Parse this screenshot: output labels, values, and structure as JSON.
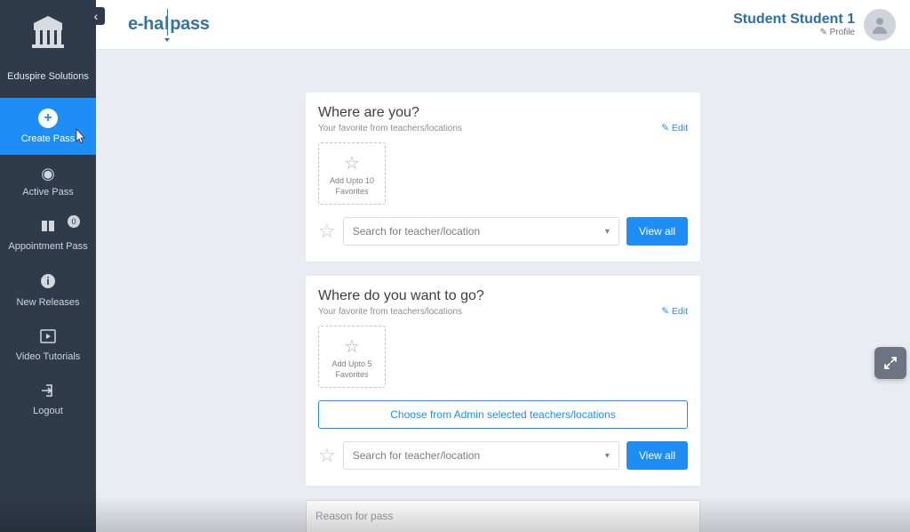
{
  "sidebar": {
    "org": "Eduspire Solutions",
    "items": [
      {
        "key": "create-pass",
        "label": "Create Pass"
      },
      {
        "key": "active-pass",
        "label": "Active Pass"
      },
      {
        "key": "appointment-pass",
        "label": "Appointment Pass",
        "badge": "0"
      },
      {
        "key": "new-releases",
        "label": "New Releases"
      },
      {
        "key": "video-tutorials",
        "label": "Video Tutorials"
      },
      {
        "key": "logout",
        "label": "Logout"
      }
    ]
  },
  "top": {
    "brand_pre": "e-ha",
    "brand_mid": "l",
    "brand_post": "pass",
    "user": "Student Student 1",
    "profile_label": "Profile"
  },
  "from": {
    "title": "Where are you?",
    "sub": "Your favorite from teachers/locations",
    "edit": "Edit",
    "fav_hint_1": "Add Upto 10",
    "fav_hint_2": "Favorites",
    "search_ph": "Search for teacher/location",
    "view_all": "View all"
  },
  "to": {
    "title": "Where do you want to go?",
    "sub": "Your favorite from teachers/locations",
    "edit": "Edit",
    "fav_hint_1": "Add Upto 5",
    "fav_hint_2": "Favorites",
    "admin_choose": "Choose from Admin selected teachers/locations",
    "search_ph": "Search for teacher/location",
    "view_all": "View all"
  },
  "reason": {
    "placeholder": "Reason for pass"
  }
}
